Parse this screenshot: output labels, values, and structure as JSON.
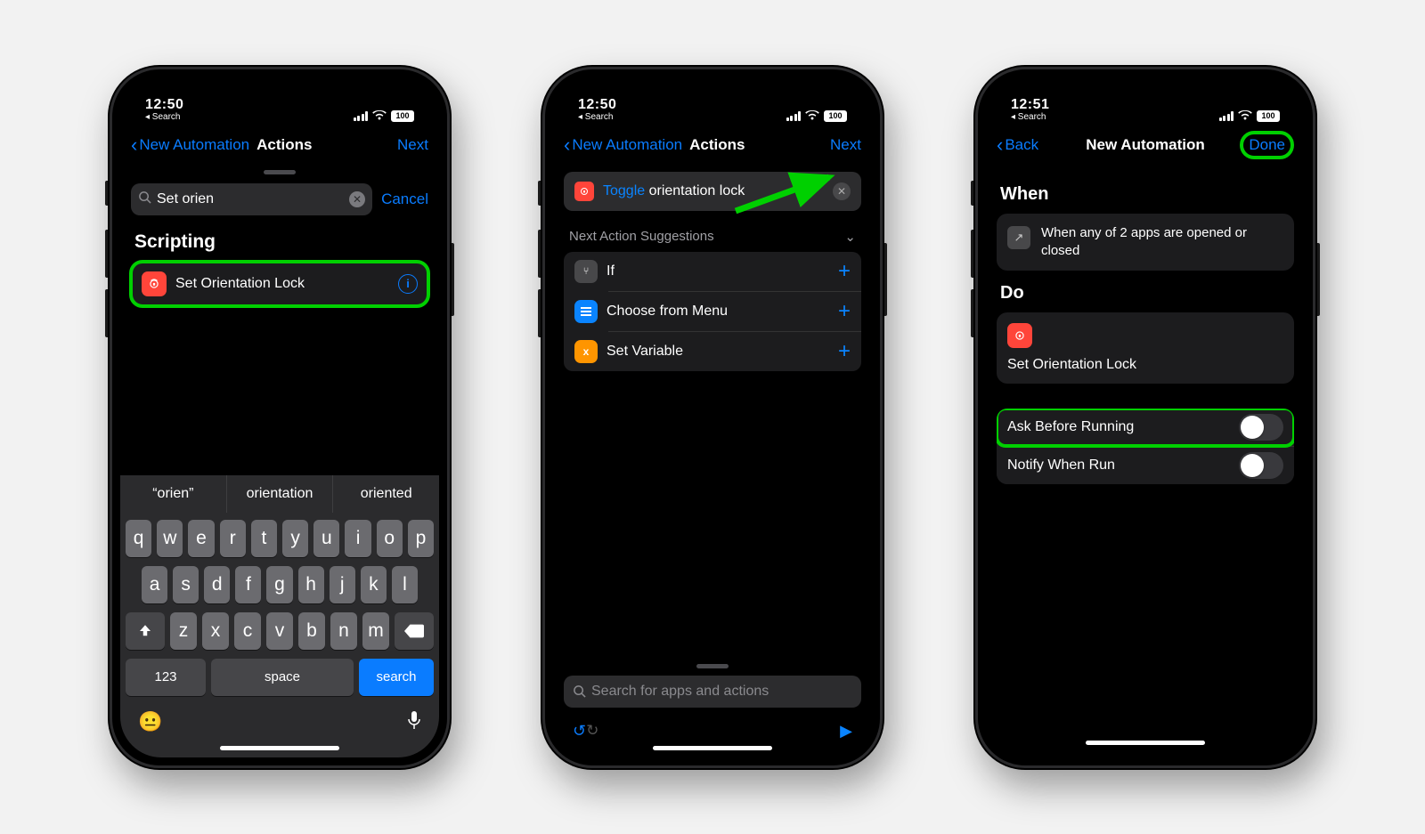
{
  "phone1": {
    "time": "12:50",
    "back_app": "◂ Search",
    "battery": "100",
    "nav_back": "New Automation",
    "nav_title": "Actions",
    "nav_right": "Next",
    "search_value": "Set orien",
    "cancel": "Cancel",
    "section": "Scripting",
    "result_label": "Set Orientation Lock",
    "predictions": [
      "“orien”",
      "orientation",
      "oriented"
    ],
    "kb_rows": [
      [
        "q",
        "w",
        "e",
        "r",
        "t",
        "y",
        "u",
        "i",
        "o",
        "p"
      ],
      [
        "a",
        "s",
        "d",
        "f",
        "g",
        "h",
        "j",
        "k",
        "l"
      ],
      [
        "z",
        "x",
        "c",
        "v",
        "b",
        "n",
        "m"
      ]
    ],
    "kb_num": "123",
    "kb_space": "space",
    "kb_search": "search"
  },
  "phone2": {
    "time": "12:50",
    "back_app": "◂ Search",
    "battery": "100",
    "nav_back": "New Automation",
    "nav_title": "Actions",
    "nav_right": "Next",
    "toggle_word": "Toggle",
    "toggle_rest": " orientation lock",
    "sug_header": "Next Action Suggestions",
    "suggestions": [
      "If",
      "Choose from Menu",
      "Set Variable"
    ],
    "search_placeholder": "Search for apps and actions"
  },
  "phone3": {
    "time": "12:51",
    "back_app": "◂ Search",
    "battery": "100",
    "nav_back": "Back",
    "nav_title": "New Automation",
    "nav_right": "Done",
    "when_header": "When",
    "when_text": "When any of 2 apps are opened or closed",
    "do_header": "Do",
    "do_label": "Set Orientation Lock",
    "toggle1": "Ask Before Running",
    "toggle2": "Notify When Run"
  }
}
